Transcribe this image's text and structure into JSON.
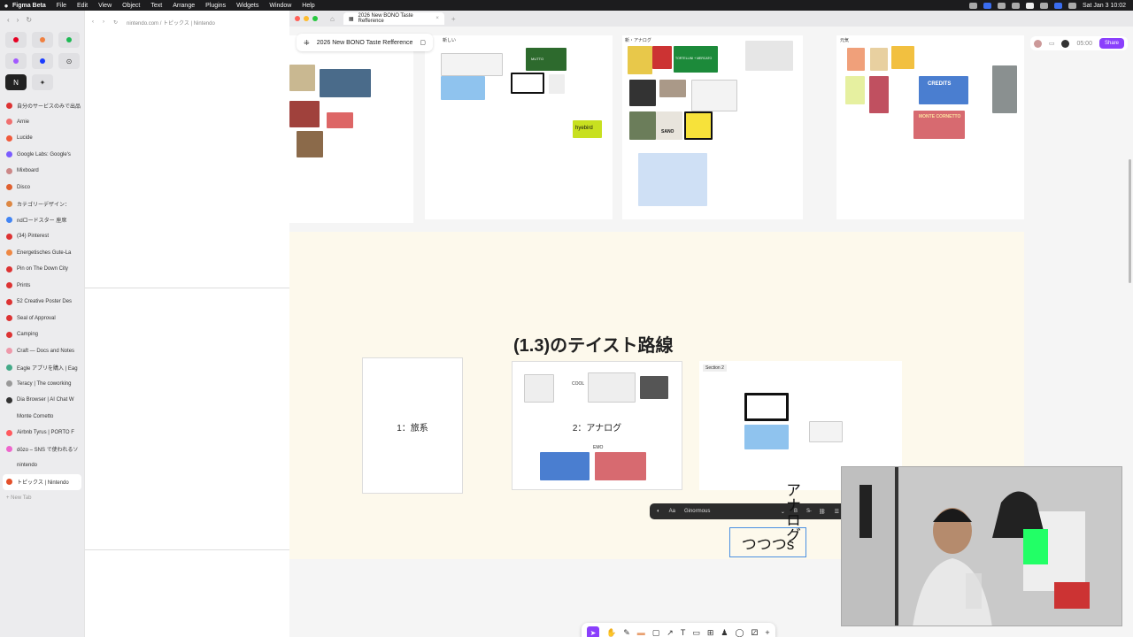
{
  "menubar": {
    "app": "Figma Beta",
    "items": [
      "File",
      "Edit",
      "View",
      "Object",
      "Text",
      "Arrange",
      "Plugins",
      "Widgets",
      "Window",
      "Help"
    ],
    "clock": "Sat Jan 3  10:02"
  },
  "sidebar": {
    "url": "nintendo.com / トピックス | Nintendo",
    "tabs": [
      "自分のサービスのみで出品",
      "Arnie",
      "Lucide",
      "Google Labs: Google's",
      "Mixboard",
      "Disco",
      "カテゴリーデザイン：",
      "ndロードスター 座席",
      "(34) Pinterest",
      "Energetisches Gute-La",
      "Pin on The Down City",
      "Prints",
      "52 Creative Poster Des",
      "Seal of Approval",
      "Camping",
      "Craft — Docs and Notes",
      "Eagle アプリを購入 | Eag",
      "Teracy | The coworking",
      "Dia Browser | AI Chat W",
      "Monte Cornetto",
      "Airbnb Tyrus | PORTO F",
      "dōzo – SNS で使われるソ",
      "nintendo",
      "トピックス | Nintendo"
    ],
    "new_tab": "+ New Tab"
  },
  "figma": {
    "tab_title": "2026 New BONO Taste Refference",
    "file_name": "2026 New BONO Taste Refference",
    "zoom": "05:00",
    "share_label": "Share",
    "frame_labels": {
      "frame2": "新しい",
      "frame3": "新・アナログ",
      "frame4": "元気"
    },
    "thumb_texts": {
      "hyebird": "hyebird",
      "credits": "CREDITS",
      "monte": "MONTE CORNETTO",
      "tortellini": "TORTELLINI + MERCATO",
      "sano": "SANO",
      "mutto": "MUTTO"
    },
    "heading": "(1.3)のテイスト路線",
    "cards": {
      "card1": "1：旅系",
      "card2": "2：アナログ",
      "card2_cool": "COOL",
      "card2_emo": "EMO",
      "section2": "Section 2"
    },
    "text_toolbar": {
      "font_size_label": "Aa",
      "font_name": "Ginormous",
      "bold": "B"
    },
    "textbox_value": "つつつs",
    "vertical_text": "アナログ"
  },
  "colors": {
    "accent": "#8a3ffc",
    "cream": "#fdf9ec",
    "selection": "#4a90e2"
  }
}
